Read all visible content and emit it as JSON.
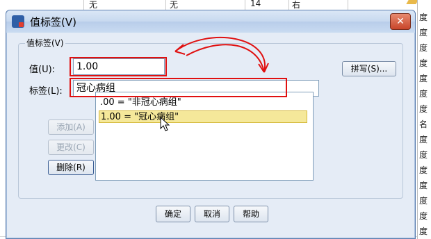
{
  "dialog": {
    "title": "值标签(V)",
    "group_label": "值标签(V)",
    "value_label": "值(U):",
    "value_input": "1.00",
    "label_label": "标签(L):",
    "label_input": "冠心病组",
    "spell_button": "拼写(S)...",
    "add_button": "添加(A)",
    "change_button": "更改(C)",
    "remove_button": "删除(R)",
    "list": [
      ".00 = \"非冠心病组\"",
      "1.00 = \"冠心病组\""
    ],
    "ok_button": "确定",
    "cancel_button": "取消",
    "help_button": "帮助",
    "close_glyph": "✕"
  },
  "sheet": {
    "top_cells": [
      "无",
      "无",
      "14",
      "右"
    ],
    "right_cells": [
      "度",
      "度",
      "度",
      "度",
      "度",
      "度",
      "度",
      "名",
      "度",
      "度",
      "度",
      "度",
      "度",
      "度",
      "度",
      "度"
    ]
  },
  "colors": {
    "annotation": "#e01010",
    "selection": "#f5e89a",
    "titlebar": "#c7d9ef"
  },
  "icons": {
    "app": "spss-app-icon",
    "cursor": "mouse-pointer-icon",
    "close": "close-icon"
  }
}
